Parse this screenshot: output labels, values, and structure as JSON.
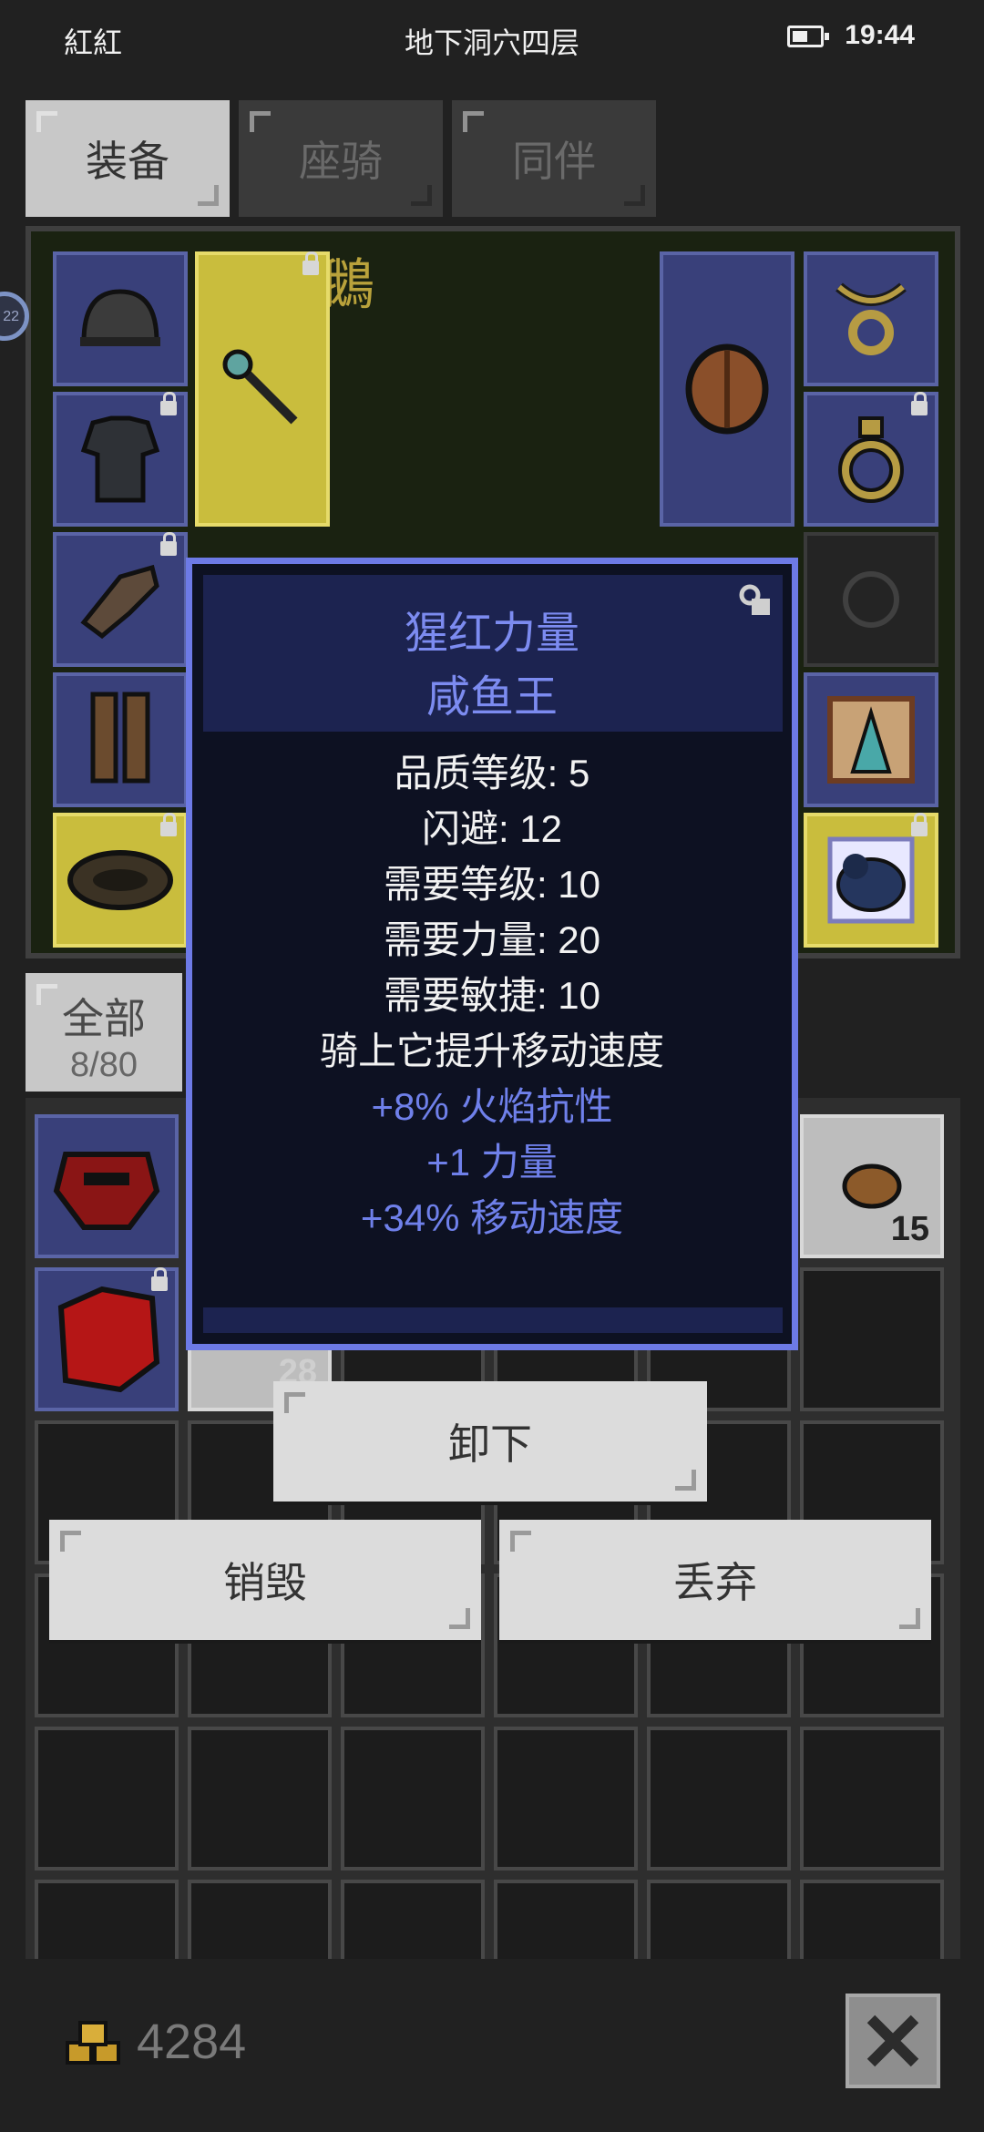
{
  "status_bar": {
    "carrier": "紅紅",
    "location": "地下洞穴四层",
    "time": "19:44",
    "icons": [
      "battery-icon"
    ]
  },
  "tabs": [
    {
      "label": "装备",
      "active": true
    },
    {
      "label": "座骑",
      "active": false
    },
    {
      "label": "同伴",
      "active": false
    }
  ],
  "equipment_panel": {
    "background_text": "騎鵝",
    "slots": [
      "helmet-icon",
      "weapon-icon",
      "shield-icon",
      "amulet-icon",
      "chest-armor-icon",
      "ring-icon",
      "glove-icon",
      "empty-ring-slot",
      "boots-icon",
      "cloak-icon",
      "belt-icon",
      "bird-mount-icon"
    ]
  },
  "side_badge": "22",
  "category": {
    "label": "全部",
    "count": "8/80"
  },
  "inventory": {
    "stack_counts": [
      "15",
      "28"
    ]
  },
  "tooltip": {
    "name": "猩红力量",
    "item": "咸鱼王",
    "stats": [
      "品质等级: 5",
      "闪避: 12",
      "需要等级: 10",
      "需要力量: 20",
      "需要敏捷: 10",
      "骑上它提升移动速度"
    ],
    "bonuses": [
      "+8% 火焰抗性",
      "+1 力量",
      "+34% 移动速度"
    ]
  },
  "actions": {
    "unequip": "卸下",
    "destroy": "销毁",
    "drop": "丢弃"
  },
  "gold": {
    "amount": "4284",
    "icon": "gold-coins-icon"
  },
  "colors": {
    "tooltip_border": "#6d7ae6",
    "tooltip_title": "#7c8bf0",
    "slot_blue": "#39407a",
    "slot_yellow": "#c9bd3d"
  }
}
